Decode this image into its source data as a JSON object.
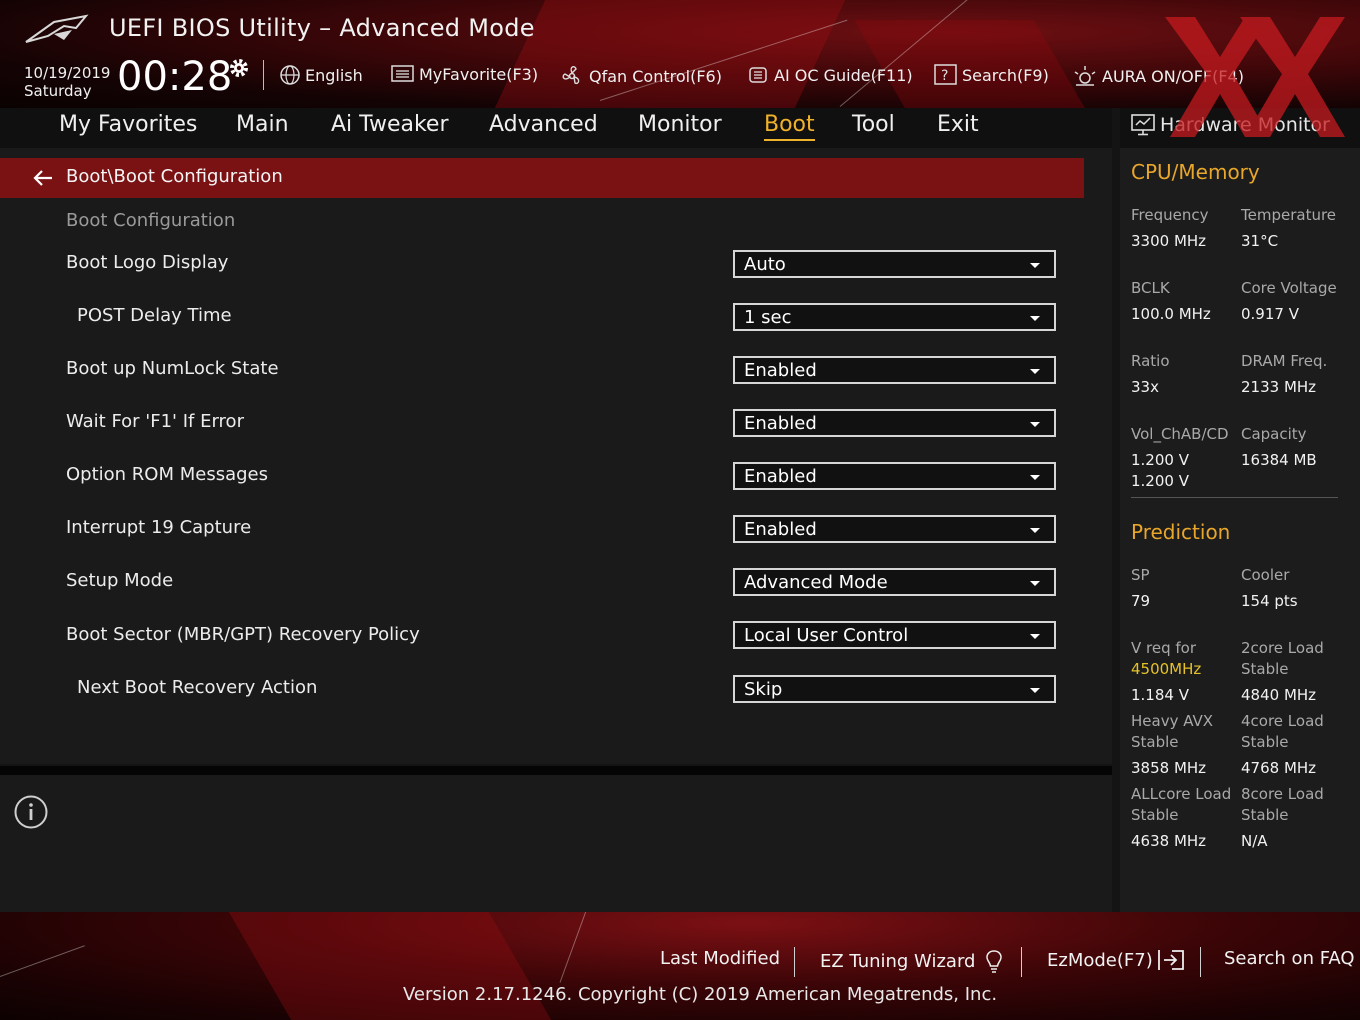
{
  "header": {
    "title": "UEFI BIOS Utility – Advanced Mode",
    "date": "10/19/2019",
    "day": "Saturday",
    "time": "00:28",
    "toolbar": [
      {
        "id": "language",
        "label": "English",
        "icon": "globe-icon"
      },
      {
        "id": "myfavorite",
        "label": "MyFavorite(F3)",
        "icon": "list-icon"
      },
      {
        "id": "qfan",
        "label": "Qfan Control(F6)",
        "icon": "fan-icon"
      },
      {
        "id": "ai-oc",
        "label": "AI OC Guide(F11)",
        "icon": "ai-chip-icon"
      },
      {
        "id": "search",
        "label": "Search(F9)",
        "icon": "question-box-icon"
      },
      {
        "id": "aura",
        "label": "AURA ON/OFF(F4)",
        "icon": "light-icon"
      }
    ]
  },
  "menu": {
    "items": [
      "My Favorites",
      "Main",
      "Ai Tweaker",
      "Advanced",
      "Monitor",
      "Boot",
      "Tool",
      "Exit"
    ],
    "active": "Boot"
  },
  "main": {
    "breadcrumb": "Boot\\Boot Configuration",
    "section_label": "Boot Configuration",
    "settings": [
      {
        "label": "Boot Logo Display",
        "value": "Auto"
      },
      {
        "label": "POST Delay Time",
        "value": "1 sec"
      },
      {
        "label": "Boot up NumLock State",
        "value": "Enabled"
      },
      {
        "label": "Wait For 'F1' If Error",
        "value": "Enabled"
      },
      {
        "label": "Option ROM Messages",
        "value": "Enabled"
      },
      {
        "label": "Interrupt 19 Capture",
        "value": "Enabled"
      },
      {
        "label": "Setup Mode",
        "value": "Advanced Mode"
      },
      {
        "label": "Boot Sector (MBR/GPT) Recovery Policy",
        "value": "Local User Control"
      },
      {
        "label": "Next Boot Recovery Action",
        "value": "Skip"
      }
    ]
  },
  "hardware_monitor": {
    "title": "Hardware Monitor",
    "cpu_memory": {
      "heading": "CPU/Memory",
      "frequency_label": "Frequency",
      "frequency": "3300 MHz",
      "temperature_label": "Temperature",
      "temperature": "31°C",
      "bclk_label": "BCLK",
      "bclk": "100.0 MHz",
      "core_voltage_label": "Core Voltage",
      "core_voltage": "0.917 V",
      "ratio_label": "Ratio",
      "ratio": "33x",
      "dram_label": "DRAM Freq.",
      "dram": "2133 MHz",
      "vol_label": "Vol_ChAB/CD",
      "vol_1": "1.200 V",
      "vol_2": "1.200 V",
      "capacity_label": "Capacity",
      "capacity": "16384 MB"
    },
    "prediction": {
      "heading": "Prediction",
      "sp_label": "SP",
      "sp": "79",
      "cooler_label": "Cooler",
      "cooler": "154 pts",
      "vreq_label": "V req for",
      "vreq_freq": "4500MHz",
      "vreq": "1.184 V",
      "core2_label_1": "2core Load",
      "core2_label_2": "Stable",
      "core2": "4840 MHz",
      "avx_label_1": "Heavy AVX",
      "avx_label_2": "Stable",
      "avx": "3858 MHz",
      "core4_label_1": "4core Load",
      "core4_label_2": "Stable",
      "core4": "4768 MHz",
      "allcore_label_1": "ALLcore Load",
      "allcore_label_2": "Stable",
      "allcore": "4638 MHz",
      "core8_label_1": "8core Load",
      "core8_label_2": "Stable",
      "core8": "N/A"
    }
  },
  "footer": {
    "last_modified": "Last Modified",
    "ez_tuning": "EZ Tuning Wizard",
    "ezmode": "EzMode(F7)",
    "faq": "Search on FAQ",
    "copyright": "Version 2.17.1246. Copyright (C) 2019 American Megatrends, Inc."
  },
  "colors": {
    "accent": "#f0b12b",
    "breadcrumb_bg": "#7a1214",
    "section_heading": "#e8a62a"
  }
}
